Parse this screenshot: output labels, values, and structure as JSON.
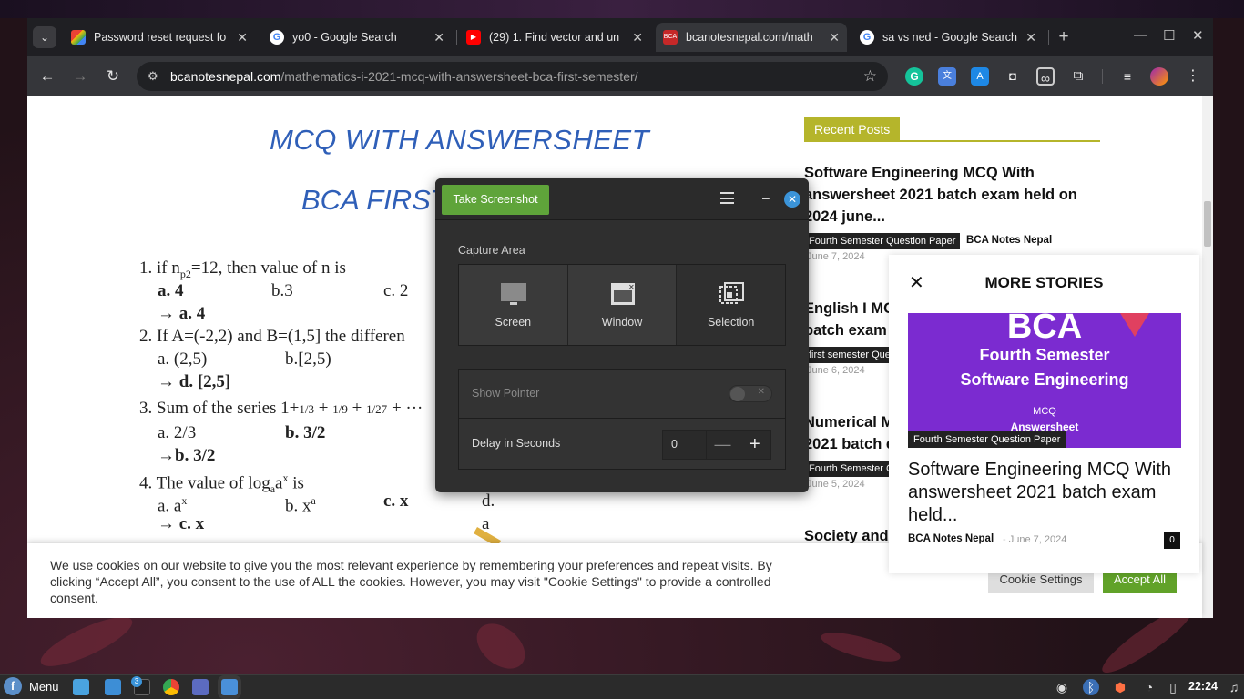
{
  "browser": {
    "tabs": [
      {
        "title": "Password reset request fo",
        "icon": "gmail-icon"
      },
      {
        "title": "yo0 - Google Search",
        "icon": "google-icon"
      },
      {
        "title": "(29) 1. Find vector and un",
        "icon": "youtube-icon"
      },
      {
        "title": "bcanotesnepal.com/math",
        "icon": "bca-icon"
      },
      {
        "title": "sa vs ned - Google Search",
        "icon": "google-icon"
      }
    ],
    "url_domain": "bcanotesnepal.com",
    "url_path": "/mathematics-i-2021-mcq-with-answersheet-bca-first-semester/"
  },
  "article": {
    "heading": "MCQ WITH ANSWERSHEET",
    "subheading": "BCA FIRST",
    "questions": [
      {
        "q": "1. if n",
        "q_sub": "p2",
        "q_rest": "=12, then value of n is",
        "opts": [
          "a. 4",
          "b.3",
          "c. 2"
        ],
        "ans": "→ a. 4"
      },
      {
        "q": "2. If A=(-2,2) and B=(1,5] the differen",
        "opts": [
          "a. (2,5)",
          "b.[2,5)"
        ],
        "ans": "→ d. [2,5]"
      },
      {
        "q": "3. Sum of the series 1+",
        "frac": [
          "1/3",
          "1/9",
          "1/27"
        ],
        "opts": [
          "a. 2/3",
          "b. 3/2"
        ],
        "ans": "→b. 3/2"
      },
      {
        "q": "4. The value of log",
        "q_sub": "a",
        "q_rest": "a",
        "q_sup": "x",
        "q_tail": " is",
        "opts": [
          "a. a",
          "b. x",
          "c. x",
          "d. a"
        ],
        "opt_sup": [
          "x",
          "a"
        ],
        "ans": "→ c. x"
      }
    ]
  },
  "sidebar": {
    "recent_label": "Recent Posts",
    "posts": [
      {
        "title": "Software Engineering MCQ With answersheet 2021 batch exam held on 2024 june...",
        "cat": "Fourth Semester Question Paper",
        "author": "BCA Notes Nepal",
        "date": "June 7, 2024"
      },
      {
        "title": "English I MC",
        "title2": "batch exam",
        "cat": "first semester Que",
        "date": "June 6, 2024"
      },
      {
        "title": "Numerical M",
        "title2": "2021 batch e",
        "cat": "Fourth Semester C",
        "date": "June 5, 2024"
      },
      {
        "title": "Society and"
      }
    ]
  },
  "cookie": {
    "text": "We use cookies on our website to give you the most relevant experience by remembering your preferences and repeat visits. By clicking “Accept All”, you consent to the use of ALL the cookies. However, you may visit \"Cookie Settings\" to provide a controlled consent.",
    "settings_label": "Cookie Settings",
    "accept_label": "Accept All"
  },
  "more_stories": {
    "title": "MORE STORIES",
    "thumb": {
      "line1": "BCA",
      "line2": "Fourth Semester",
      "line3": "Software Engineering",
      "line4": "MCQ",
      "line5": "Answersheet"
    },
    "category": "Fourth Semester Question Paper",
    "post": "Software Engineering MCQ With answersheet 2021 batch exam held...",
    "author": "BCA Notes Nepal",
    "date": "June 7, 2024",
    "comments": "0"
  },
  "screenshot_dialog": {
    "take_label": "Take Screenshot",
    "capture_label": "Capture Area",
    "modes": [
      "Screen",
      "Window",
      "Selection"
    ],
    "selected_mode": "Selection",
    "show_pointer_label": "Show Pointer",
    "show_pointer": false,
    "delay_label": "Delay in Seconds",
    "delay_value": "0"
  },
  "taskbar": {
    "menu_label": "Menu",
    "badge": "3",
    "clock": "22:24"
  }
}
